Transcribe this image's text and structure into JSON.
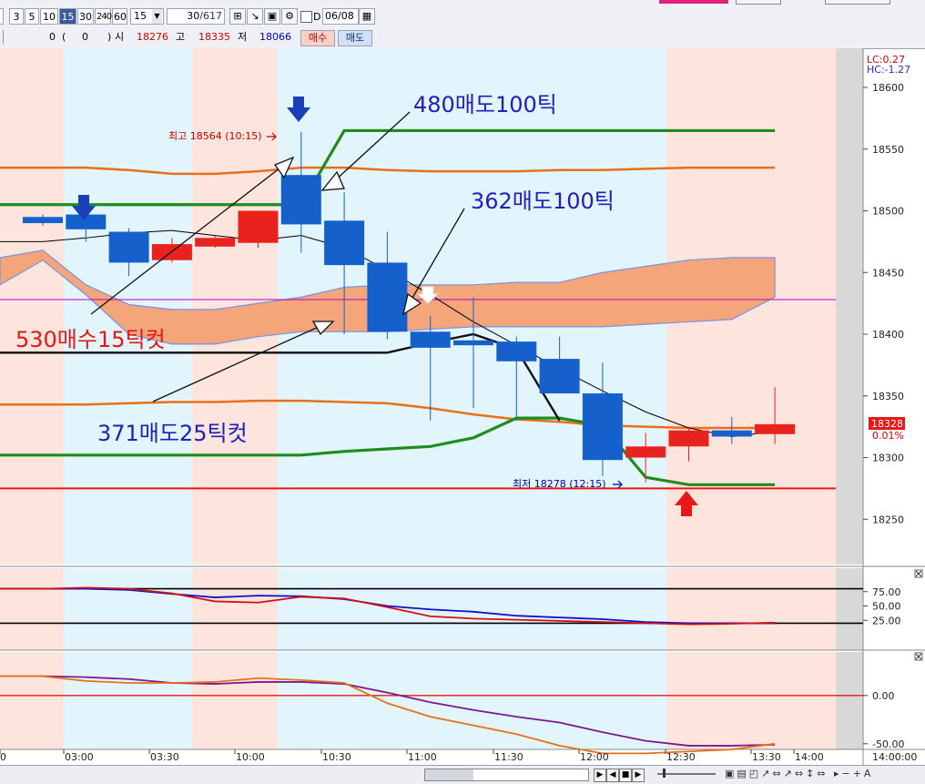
{
  "toolbar": {
    "period_buttons": [
      "3",
      "5",
      "10",
      "15",
      "30",
      "240",
      "60"
    ],
    "active_period": "15",
    "period_select": "15",
    "count_value": "30",
    "count_total": "/617",
    "checkbox_label": "D",
    "date_value": "06/08"
  },
  "quote_bar": {
    "volume": "0",
    "change_open": "(",
    "change_value": "0",
    "change_close": ")",
    "open_label": "시",
    "open_value": "18276",
    "high_label": "고",
    "high_value": "18335",
    "low_label": "저",
    "low_value": "18066",
    "buy_button": "매수",
    "sell_button": "매도"
  },
  "chart_data": [
    {
      "type": "candlestick",
      "title": "",
      "ylim": [
        18200,
        18620
      ],
      "y_ticks": [
        "18600",
        "18550",
        "18500",
        "18450",
        "18400",
        "18350",
        "18300",
        "18250"
      ],
      "x_ticks": [
        "0",
        "03:00",
        "03:30",
        "10:00",
        "10:30",
        "11:00",
        "11:30",
        "12:00",
        "12:30",
        "13:30",
        "14:00"
      ],
      "x_tick_last": "14:00:00",
      "candles": [
        {
          "o": 18495,
          "c": 18490,
          "h": 18497,
          "l": 18488
        },
        {
          "o": 18497,
          "c": 18485,
          "h": 18498,
          "l": 18475
        },
        {
          "o": 18483,
          "c": 18458,
          "h": 18486,
          "l": 18447
        },
        {
          "o": 18460,
          "c": 18473,
          "h": 18478,
          "l": 18458
        },
        {
          "o": 18471,
          "c": 18478,
          "h": 18480,
          "l": 18470
        },
        {
          "o": 18474,
          "c": 18500,
          "h": 18500,
          "l": 18470
        },
        {
          "o": 18529,
          "c": 18489,
          "h": 18564,
          "l": 18466
        },
        {
          "o": 18492,
          "c": 18456,
          "h": 18515,
          "l": 18400
        },
        {
          "o": 18458,
          "c": 18402,
          "h": 18483,
          "l": 18396
        },
        {
          "o": 18402,
          "c": 18389,
          "h": 18415,
          "l": 18330
        },
        {
          "o": 18395,
          "c": 18391,
          "h": 18430,
          "l": 18340
        },
        {
          "o": 18394,
          "c": 18378,
          "h": 18398,
          "l": 18330
        },
        {
          "o": 18380,
          "c": 18352,
          "h": 18398,
          "l": 18352
        },
        {
          "o": 18352,
          "c": 18298,
          "h": 18377,
          "l": 18285
        },
        {
          "o": 18300,
          "c": 18309,
          "h": 18320,
          "l": 18280
        },
        {
          "o": 18309,
          "c": 18322,
          "h": 18325,
          "l": 18297
        },
        {
          "o": 18322,
          "c": 18317,
          "h": 18333,
          "l": 18311
        },
        {
          "o": 18319,
          "c": 18327,
          "h": 18357,
          "l": 18311
        }
      ],
      "candle_colors": {
        "up": "#e8221c",
        "down": "#1660cc"
      },
      "lines": [
        {
          "color": "#e8701a",
          "points": [
            18535,
            18535,
            18533,
            18530,
            18530,
            18532,
            18535,
            18535,
            18533,
            18532,
            18532,
            18532,
            18533,
            18533,
            18534,
            18535,
            18535,
            18535
          ]
        },
        {
          "color": "#e8701a",
          "points": [
            18343,
            18343,
            18344,
            18345,
            18345,
            18346,
            18346,
            18345,
            18344,
            18340,
            18335,
            18331,
            18329,
            18326,
            18325,
            18324,
            18324,
            18324
          ]
        },
        {
          "color": "#1e8c1e",
          "points": [
            18505,
            18505,
            18505,
            18505,
            18505,
            18505,
            18505,
            18565,
            18565,
            18565,
            18565,
            18565,
            18565,
            18565,
            18565,
            18565,
            18565,
            18565
          ]
        },
        {
          "color": "#1e8c1e",
          "points": [
            18302,
            18302,
            18302,
            18302,
            18302,
            18302,
            18302,
            18305,
            18307,
            18309,
            18316,
            18332,
            18332,
            18326,
            18284,
            18278,
            18278,
            18278
          ]
        },
        {
          "color": "#000000",
          "points": [
            18475,
            18478,
            18482,
            18484,
            18480,
            18476,
            18480,
            18470,
            18452,
            18432,
            18410,
            18391,
            18372,
            18354,
            18337,
            18324,
            18317,
            18321
          ]
        }
      ],
      "horizontal_lines": [
        {
          "value": 18275,
          "color": "#e81818"
        },
        {
          "value": 18428,
          "color": "#c000c0"
        }
      ],
      "high_label": "최고 18564 (10:15)",
      "low_label": "최저 18278 (12:15)",
      "current_price": "18328",
      "current_change": "0.01%",
      "lc_label": "LC:0.27",
      "hc_label": "HC:-1.27",
      "annotations": [
        {
          "text": "480매도100틱",
          "color": "#2020b8"
        },
        {
          "text": "362매도100틱",
          "color": "#2020b8"
        },
        {
          "text": "530매수15틱컷",
          "color": "#e01818"
        },
        {
          "text": "371매도25틱컷",
          "color": "#2020b8"
        }
      ]
    },
    {
      "type": "line",
      "title": "",
      "ylim": [
        0,
        100
      ],
      "y_ticks": [
        "75.00",
        "50.00",
        "25.00"
      ],
      "reference_lines": [
        80,
        20
      ],
      "series": [
        {
          "color": "#1010d0",
          "values": [
            80,
            80,
            78,
            71,
            65,
            68,
            67,
            62,
            50,
            44,
            40,
            33,
            30,
            27,
            22,
            20,
            20,
            20
          ]
        },
        {
          "color": "#d41010",
          "values": [
            80,
            82,
            80,
            72,
            58,
            56,
            66,
            63,
            48,
            32,
            28,
            26,
            24,
            22,
            20,
            18,
            19,
            21
          ]
        }
      ]
    },
    {
      "type": "line",
      "title": "",
      "ylim": [
        -70,
        30
      ],
      "y_ticks": [
        "0.00",
        "-50.00"
      ],
      "reference_lines": [
        0
      ],
      "series": [
        {
          "color": "#7a1a8c",
          "values": [
            20,
            19,
            17,
            13,
            12,
            14,
            14,
            12,
            3,
            -7,
            -15,
            -22,
            -28,
            -38,
            -47,
            -52,
            -52,
            -51
          ]
        },
        {
          "color": "#e8701a",
          "values": [
            20,
            15,
            13,
            13,
            14,
            18,
            16,
            13,
            -8,
            -22,
            -31,
            -40,
            -52,
            -60,
            -60,
            -58,
            -56,
            -50
          ]
        }
      ]
    }
  ]
}
